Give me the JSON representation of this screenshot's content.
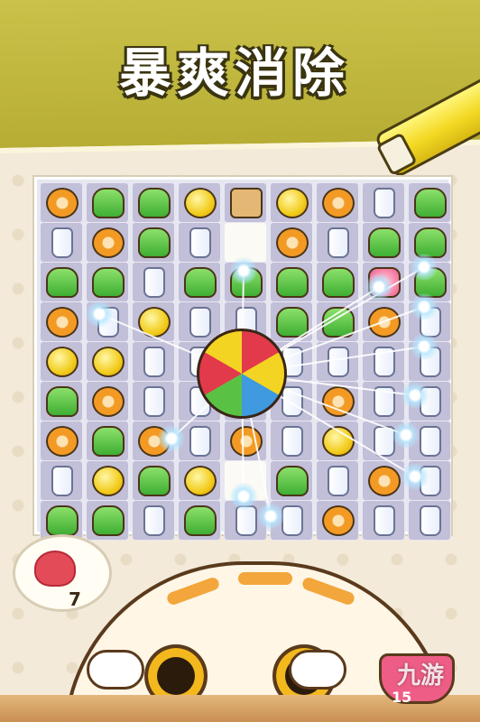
{
  "banner": {
    "title": "暴爽消除"
  },
  "board": {
    "rows": [
      [
        "orange",
        "green",
        "green",
        "yellow",
        "bread",
        "yellow",
        "orange",
        "milk",
        "green"
      ],
      [
        "milk",
        "orange",
        "green",
        "milk",
        "empty",
        "orange",
        "milk",
        "green",
        "green"
      ],
      [
        "green",
        "green",
        "milk",
        "green",
        "green",
        "green",
        "green",
        "pink",
        "green"
      ],
      [
        "orange",
        "milk",
        "yellow",
        "milk",
        "milk",
        "green",
        "green",
        "orange",
        "milk"
      ],
      [
        "yellow",
        "yellow",
        "milk",
        "milk",
        "milk",
        "milk",
        "milk",
        "milk",
        "milk"
      ],
      [
        "green",
        "orange",
        "milk",
        "milk",
        "milk",
        "milk",
        "orange",
        "milk",
        "milk"
      ],
      [
        "orange",
        "green",
        "orange",
        "milk",
        "orange",
        "milk",
        "yellow",
        "milk",
        "milk"
      ],
      [
        "milk",
        "yellow",
        "green",
        "yellow",
        "empty",
        "green",
        "milk",
        "orange",
        "milk"
      ],
      [
        "green",
        "green",
        "milk",
        "green",
        "milk",
        "milk",
        "orange",
        "milk",
        "milk"
      ]
    ],
    "booster": "yarn-ball"
  },
  "goal": {
    "item": "fish-icon",
    "count": "7"
  },
  "bowl": {
    "count": "15"
  },
  "watermark": "九游"
}
